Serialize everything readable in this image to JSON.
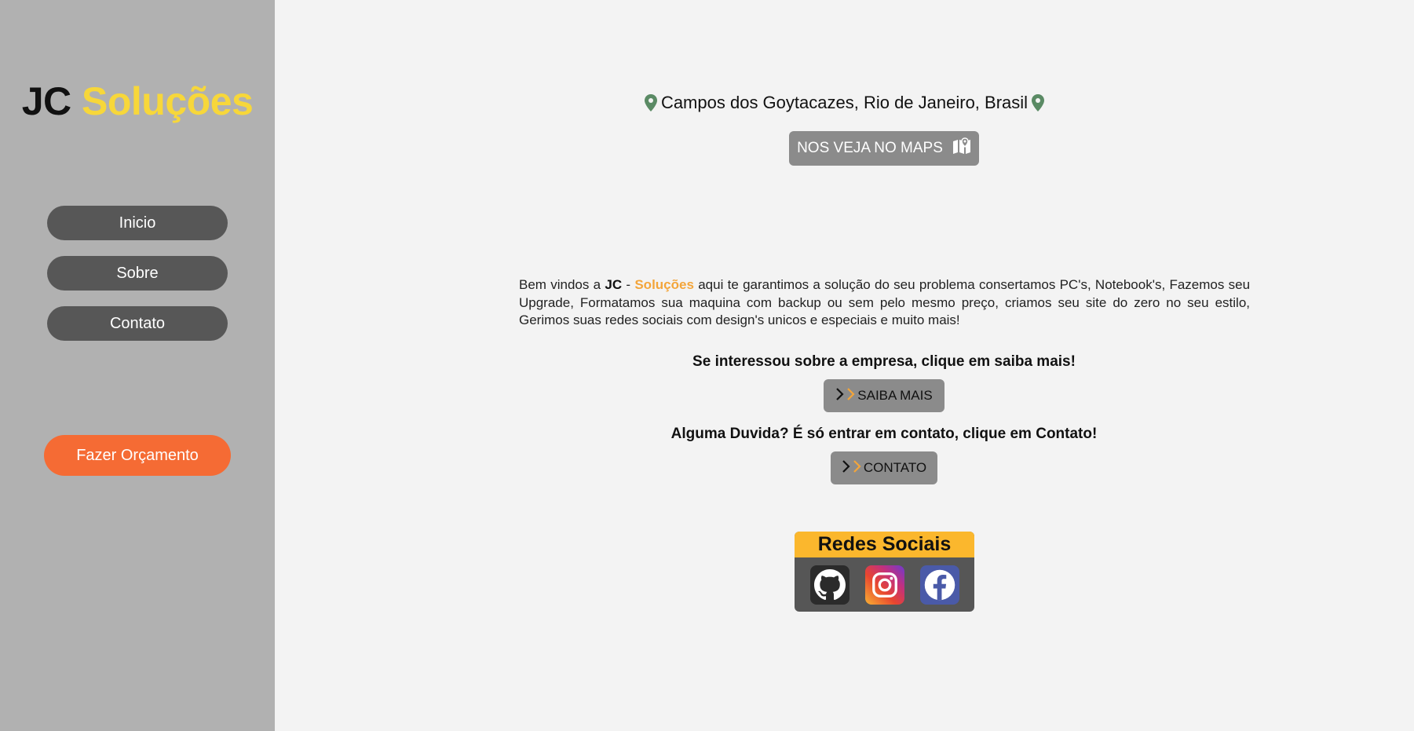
{
  "brand": {
    "part1": "JC",
    "part2": "Soluções"
  },
  "nav": {
    "items": [
      {
        "label": "Inicio"
      },
      {
        "label": "Sobre"
      },
      {
        "label": "Contato"
      }
    ]
  },
  "quote_button": {
    "label": "Fazer Orçamento"
  },
  "location": {
    "text": "Campos dos Goytacazes, Rio de Janeiro, Brasil"
  },
  "maps_button": {
    "label": "NOS VEJA NO MAPS",
    "icon": "map-icon"
  },
  "intro": {
    "p1": "Bem vindos a",
    "brand1": "JC",
    "dash": "-",
    "brand2": "Soluções",
    "p2": "aqui te garantimos a solução do seu problema consertamos PC's, Notebook's, Fazemos seu Upgrade, Formatamos sua maquina com backup ou sem pelo mesmo preço, criamos seu site do zero no seu estilo, Gerimos suas redes sociais com design's unicos e especiais e muito mais!"
  },
  "cta1": {
    "question": "Se interessou sobre a empresa, clique em saiba mais!",
    "button": "SAIBA MAIS"
  },
  "cta2": {
    "question": "Alguma Duvida? É só entrar em contato, clique em Contato!",
    "button": "CONTATO"
  },
  "social": {
    "title": "Redes Sociais",
    "icons": [
      "github-icon",
      "instagram-icon",
      "facebook-icon"
    ]
  },
  "colors": {
    "sidebar": "#b1b1b1",
    "nav_button": "#575757",
    "quote_button": "#f56b34",
    "brand_yellow": "#f7d73a",
    "accent_orange": "#f3a53a",
    "social_header": "#fbb72d",
    "gray_button": "#8b8b8b",
    "pin_green": "#5a8a64"
  }
}
